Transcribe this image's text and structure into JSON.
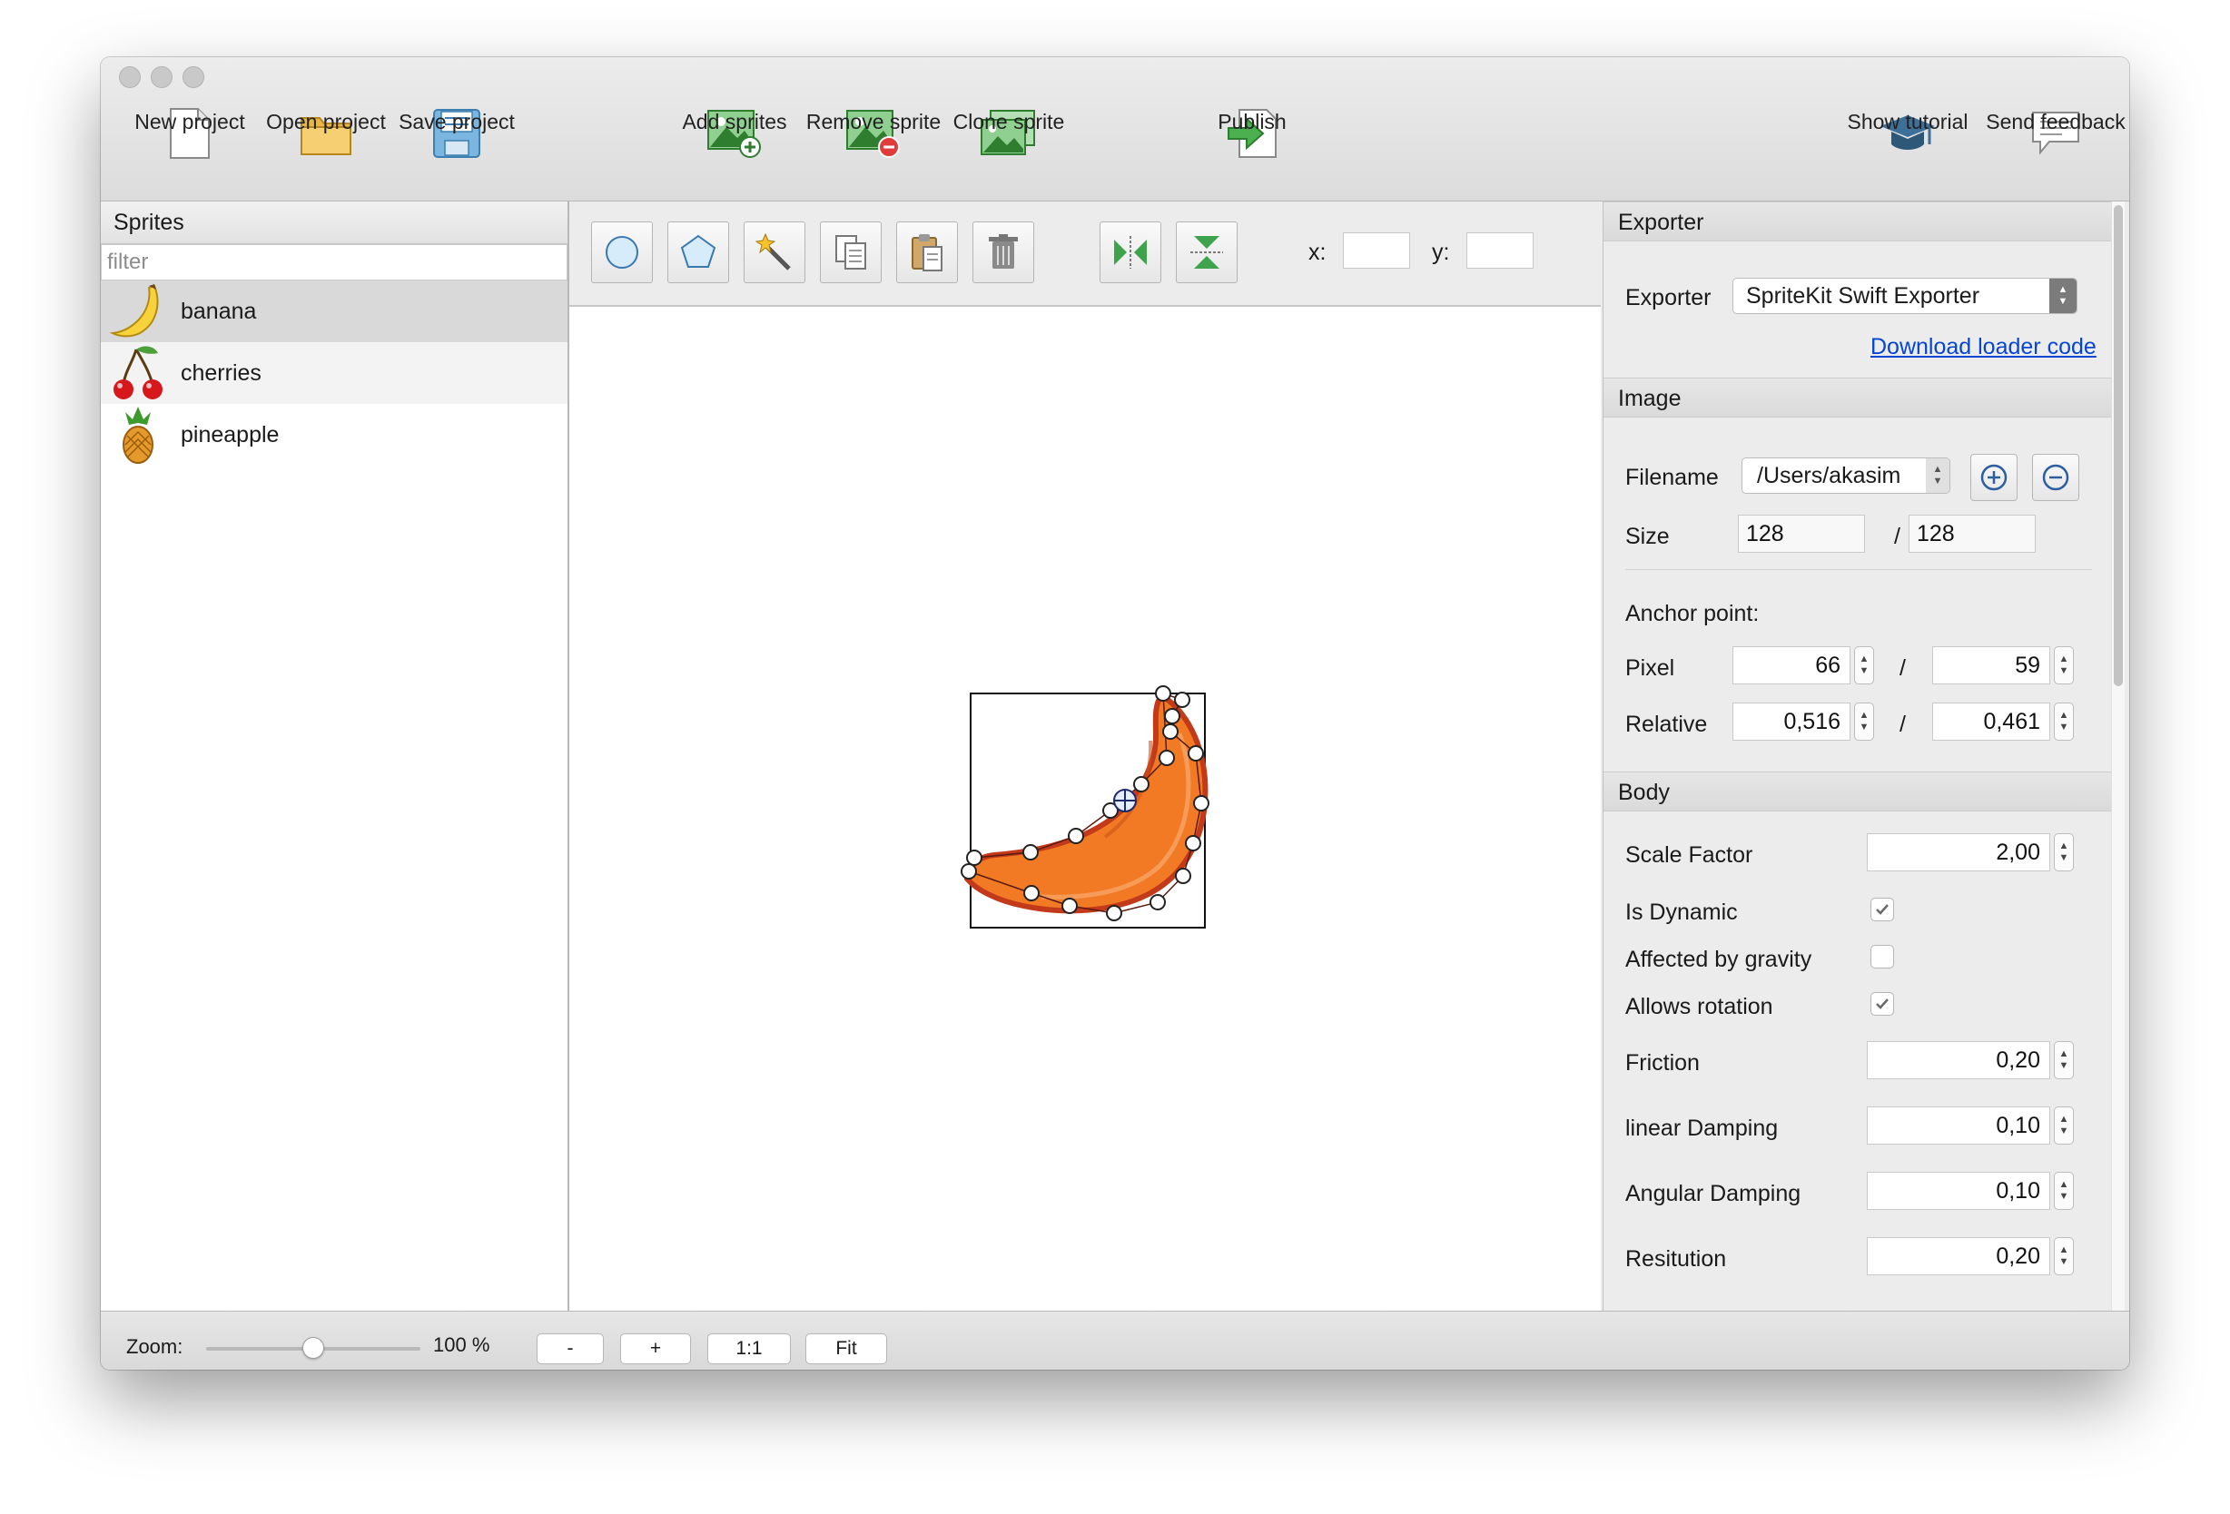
{
  "toolbar": {
    "new_project": "New project",
    "open_project": "Open project",
    "save_project": "Save project",
    "add_sprites": "Add sprites",
    "remove_sprite": "Remove sprite",
    "clone_sprite": "Clone sprite",
    "publish": "Publish",
    "show_tutorial": "Show tutorial",
    "send_feedback": "Send feedback"
  },
  "sprites": {
    "header": "Sprites",
    "filter_placeholder": "filter",
    "items": [
      {
        "name": "banana",
        "icon": "banana-icon",
        "selected": true
      },
      {
        "name": "cherries",
        "icon": "cherries-icon"
      },
      {
        "name": "pineapple",
        "icon": "pineapple-icon"
      }
    ]
  },
  "editor": {
    "tools": [
      "circle-tool-icon",
      "polygon-tool-icon",
      "magic-wand-icon",
      "copy-icon",
      "paste-icon",
      "trash-icon",
      "flip-horizontal-icon",
      "flip-vertical-icon"
    ],
    "x_label": "x:",
    "y_label": "y:",
    "x_value": "",
    "y_value": ""
  },
  "inspector": {
    "exporter_header": "Exporter",
    "exporter_label": "Exporter",
    "exporter_value": "SpriteKit Swift Exporter",
    "download_link": "Download loader code",
    "image_header": "Image",
    "filename_label": "Filename",
    "filename_value": "/Users/akasim",
    "size_label": "Size",
    "size_width": "128",
    "size_height": "128",
    "slash": "/",
    "anchor_label": "Anchor point:",
    "pixel_label": "Pixel",
    "pixel_x": "66",
    "pixel_y": "59",
    "relative_label": "Relative",
    "relative_x": "0,516",
    "relative_y": "0,461",
    "body_header": "Body",
    "scale_label": "Scale Factor",
    "scale_value": "2,00",
    "dynamic_label": "Is Dynamic",
    "dynamic_checked": true,
    "gravity_label": "Affected by gravity",
    "gravity_checked": false,
    "rotation_label": "Allows rotation",
    "rotation_checked": true,
    "friction_label": "Friction",
    "friction_value": "0,20",
    "linear_label": "linear Damping",
    "linear_value": "0,10",
    "angular_label": "Angular Damping",
    "angular_value": "0,10",
    "restitution_label": "Resitution",
    "restitution_value": "0,20"
  },
  "status": {
    "zoom_label": "Zoom:",
    "zoom_value": "100 %",
    "zoom_fraction": 0.5,
    "minus": "-",
    "plus": "+",
    "one_to_one": "1:1",
    "fit": "Fit"
  },
  "colors": {
    "banana_fill": "#f27a24",
    "banana_edge": "#c23a1a",
    "link": "#0645d4",
    "icon_green": "#3e9a3e"
  }
}
